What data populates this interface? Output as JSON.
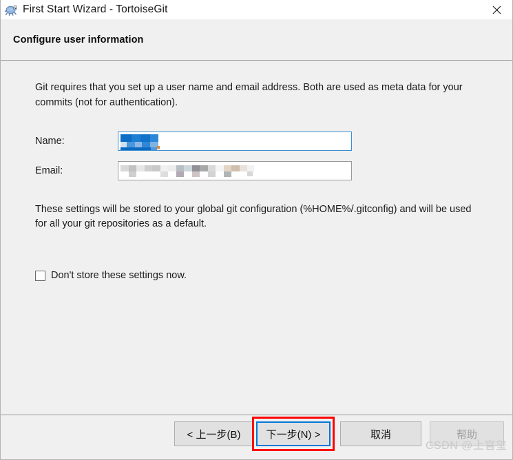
{
  "window": {
    "title": "First Start Wizard - TortoiseGit",
    "app_icon": "tortoise-icon",
    "close_label": "✕"
  },
  "header": {
    "title": "Configure user information"
  },
  "content": {
    "intro_paragraph": "Git requires that you set up a user name and email address. Both are used as meta data for your commits (not for authentication).",
    "fields": [
      {
        "label": "Name:",
        "value": "",
        "censored": true,
        "censor_style": "selection-blue"
      },
      {
        "label": "Email:",
        "value": "",
        "censored": true,
        "censor_style": "mosaic-gray"
      }
    ],
    "storage_paragraph": "These settings will be stored to your global git configuration (%HOME%/.gitconfig) and will be used for all your git repositories as a default.",
    "checkbox": {
      "label": "Don't store these settings now.",
      "checked": false
    }
  },
  "footer": {
    "buttons": [
      {
        "name": "back",
        "label": "< 上一步(B)",
        "enabled": true,
        "focused": false
      },
      {
        "name": "next",
        "label": "下一步(N) >",
        "enabled": true,
        "focused": true
      },
      {
        "name": "cancel",
        "label": "取消",
        "enabled": true,
        "focused": false
      },
      {
        "name": "help",
        "label": "帮助",
        "enabled": false,
        "focused": false
      }
    ]
  },
  "annotation": {
    "color": "#ff0000",
    "target": "next-button"
  },
  "watermark": {
    "text": "CSDN @上官玺",
    "color": "#c9c9c9"
  },
  "colors": {
    "titlebar_bg": "#ffffff",
    "window_bg": "#f0f0f0",
    "button_bg": "#e1e1e1",
    "focus_blue": "#0078d7",
    "selection_blue": "#0c6dc4",
    "annotation_red": "#ff0000"
  }
}
